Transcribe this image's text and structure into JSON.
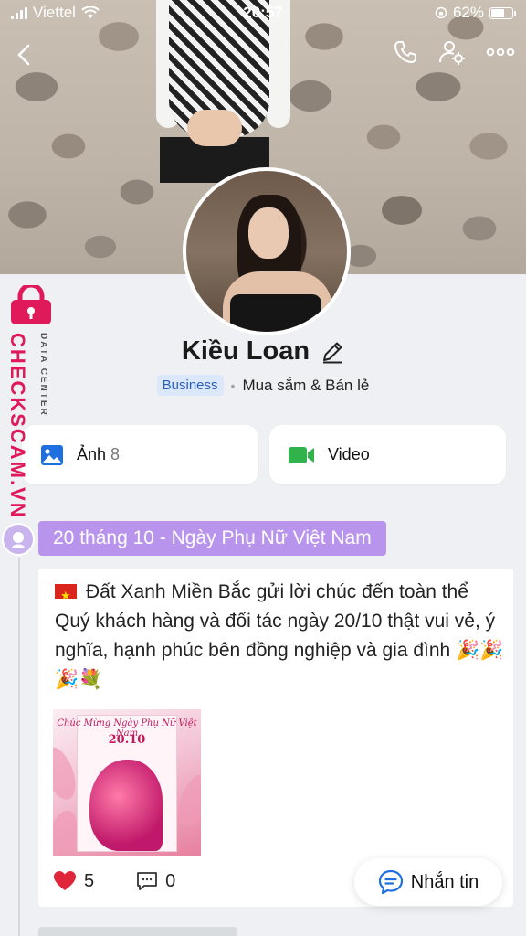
{
  "status_bar": {
    "carrier": "Viettel",
    "time": "20:57",
    "battery": "62%"
  },
  "profile": {
    "name": "Kiều Loan",
    "badge": "Business",
    "category": "Mua sắm & Bán lẻ"
  },
  "media": {
    "photos_label": "Ảnh",
    "photos_count": "8",
    "video_label": "Video"
  },
  "watermark": {
    "brand": "CHECKSCAM.VN",
    "sub": "DATA CENTER"
  },
  "timeline": {
    "event_title": "20 tháng 10 - Ngày Phụ Nữ Việt Nam",
    "post": {
      "text": "Đất Xanh Miền Bắc gửi lời chúc đến toàn thể Quý khách hàng và đối tác ngày 20/10 thật vui vẻ, ý nghĩa, hạnh phúc bên đồng nghiệp và gia đình 🎉🎉🎉💐",
      "image_title_1": "Chúc Mừng Ngày Phụ Nữ Việt Nam",
      "image_title_2": "20.10",
      "likes": "5",
      "comments": "0"
    }
  },
  "chat_button": {
    "label": "Nhắn tin"
  },
  "colors": {
    "accent_purple": "#b994ec",
    "badge_blue": "#2a5fb8",
    "watermark_pink": "#e0195a",
    "like_red": "#e0253a",
    "photo_icon": "#1f6fe0",
    "video_icon": "#2fb34a"
  }
}
